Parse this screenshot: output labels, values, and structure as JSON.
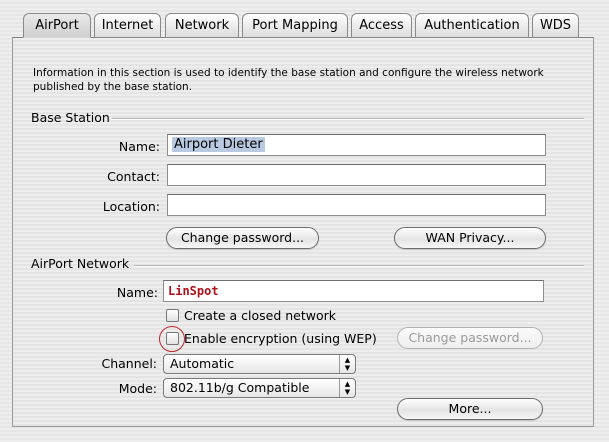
{
  "tabs": [
    {
      "label": "AirPort",
      "active": true
    },
    {
      "label": "Internet",
      "active": false
    },
    {
      "label": "Network",
      "active": false
    },
    {
      "label": "Port Mapping",
      "active": false
    },
    {
      "label": "Access",
      "active": false
    },
    {
      "label": "Authentication",
      "active": false
    },
    {
      "label": "WDS",
      "active": false
    }
  ],
  "info_text": "Information in this section is used to identify the base station and configure the wireless network published by the base station.",
  "base_station": {
    "title": "Base Station",
    "name_label": "Name:",
    "name_value": "Airport Dieter",
    "contact_label": "Contact:",
    "contact_value": "",
    "location_label": "Location:",
    "location_value": "",
    "change_password_label": "Change password...",
    "wan_privacy_label": "WAN Privacy..."
  },
  "airport_network": {
    "title": "AirPort Network",
    "name_label": "Name:",
    "name_value": "LinSpot",
    "closed_network_label": "Create a closed network",
    "closed_network_checked": false,
    "encryption_label": "Enable encryption (using WEP)",
    "encryption_checked": false,
    "change_password_label": "Change password...",
    "channel_label": "Channel:",
    "channel_value": "Automatic",
    "mode_label": "Mode:",
    "mode_value": "802.11b/g Compatible",
    "more_label": "More..."
  },
  "colors": {
    "highlight_ring": "#c0282c",
    "network_name_text": "#b0101a",
    "selection": "#b9c9e2"
  }
}
